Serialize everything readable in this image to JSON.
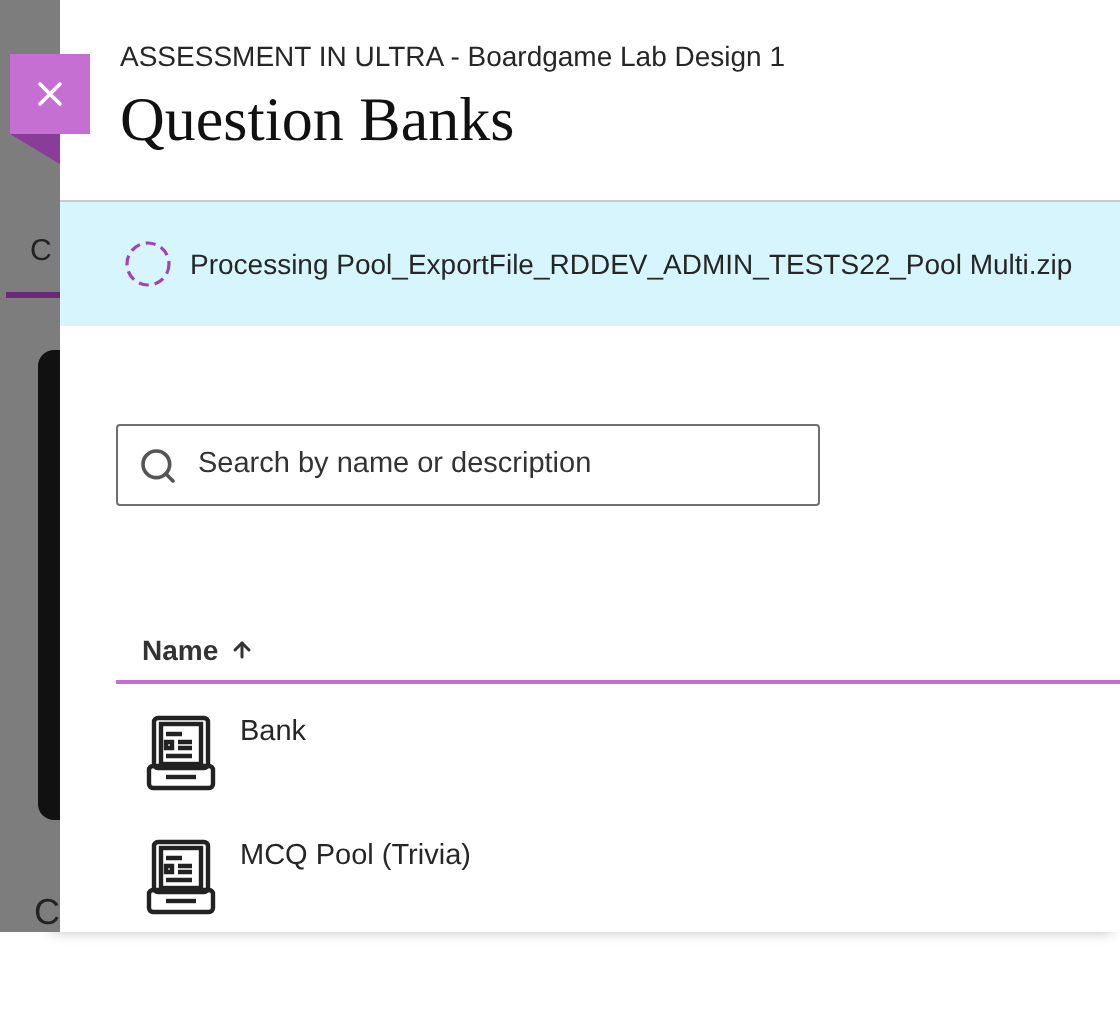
{
  "background": {
    "tab_label": "C",
    "footer_label": "C"
  },
  "panel": {
    "breadcrumb": "ASSESSMENT IN ULTRA - Boardgame Lab Design 1",
    "title": "Question Banks",
    "banner": {
      "text": "Processing Pool_ExportFile_RDDEV_ADMIN_TESTS22_Pool Multi.zip"
    },
    "search": {
      "placeholder": "Search by name or description"
    },
    "table": {
      "columns": [
        {
          "label": "Name",
          "ascending": true
        }
      ],
      "rows": [
        {
          "name": "Bank"
        },
        {
          "name": "MCQ Pool (Trivia)"
        }
      ]
    }
  }
}
